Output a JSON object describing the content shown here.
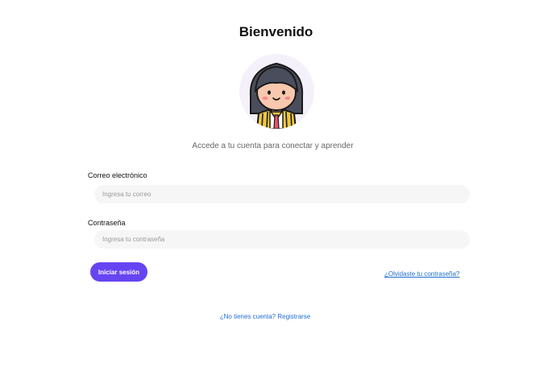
{
  "header": {
    "title": "Bienvenido",
    "subtitle": "Accede a tu cuenta para conectar y aprender",
    "avatar_icon": "girl-avatar-icon"
  },
  "form": {
    "email": {
      "label": "Correo electrónico",
      "placeholder": "Ingresa tu correo",
      "value": ""
    },
    "password": {
      "label": "Contraseña",
      "placeholder": "Ingresa tu contraseña",
      "value": ""
    },
    "submit_label": "Iniciar sesión",
    "forgot_label": "¿Olvidaste tu contraseña?"
  },
  "footer": {
    "register_label": "¿No tienes cuenta? Registrarse"
  },
  "colors": {
    "accent": "#6644f2",
    "link": "#1f6fd1",
    "input_bg": "#f6f6f6",
    "avatar_bg": "#f4f1fb"
  }
}
